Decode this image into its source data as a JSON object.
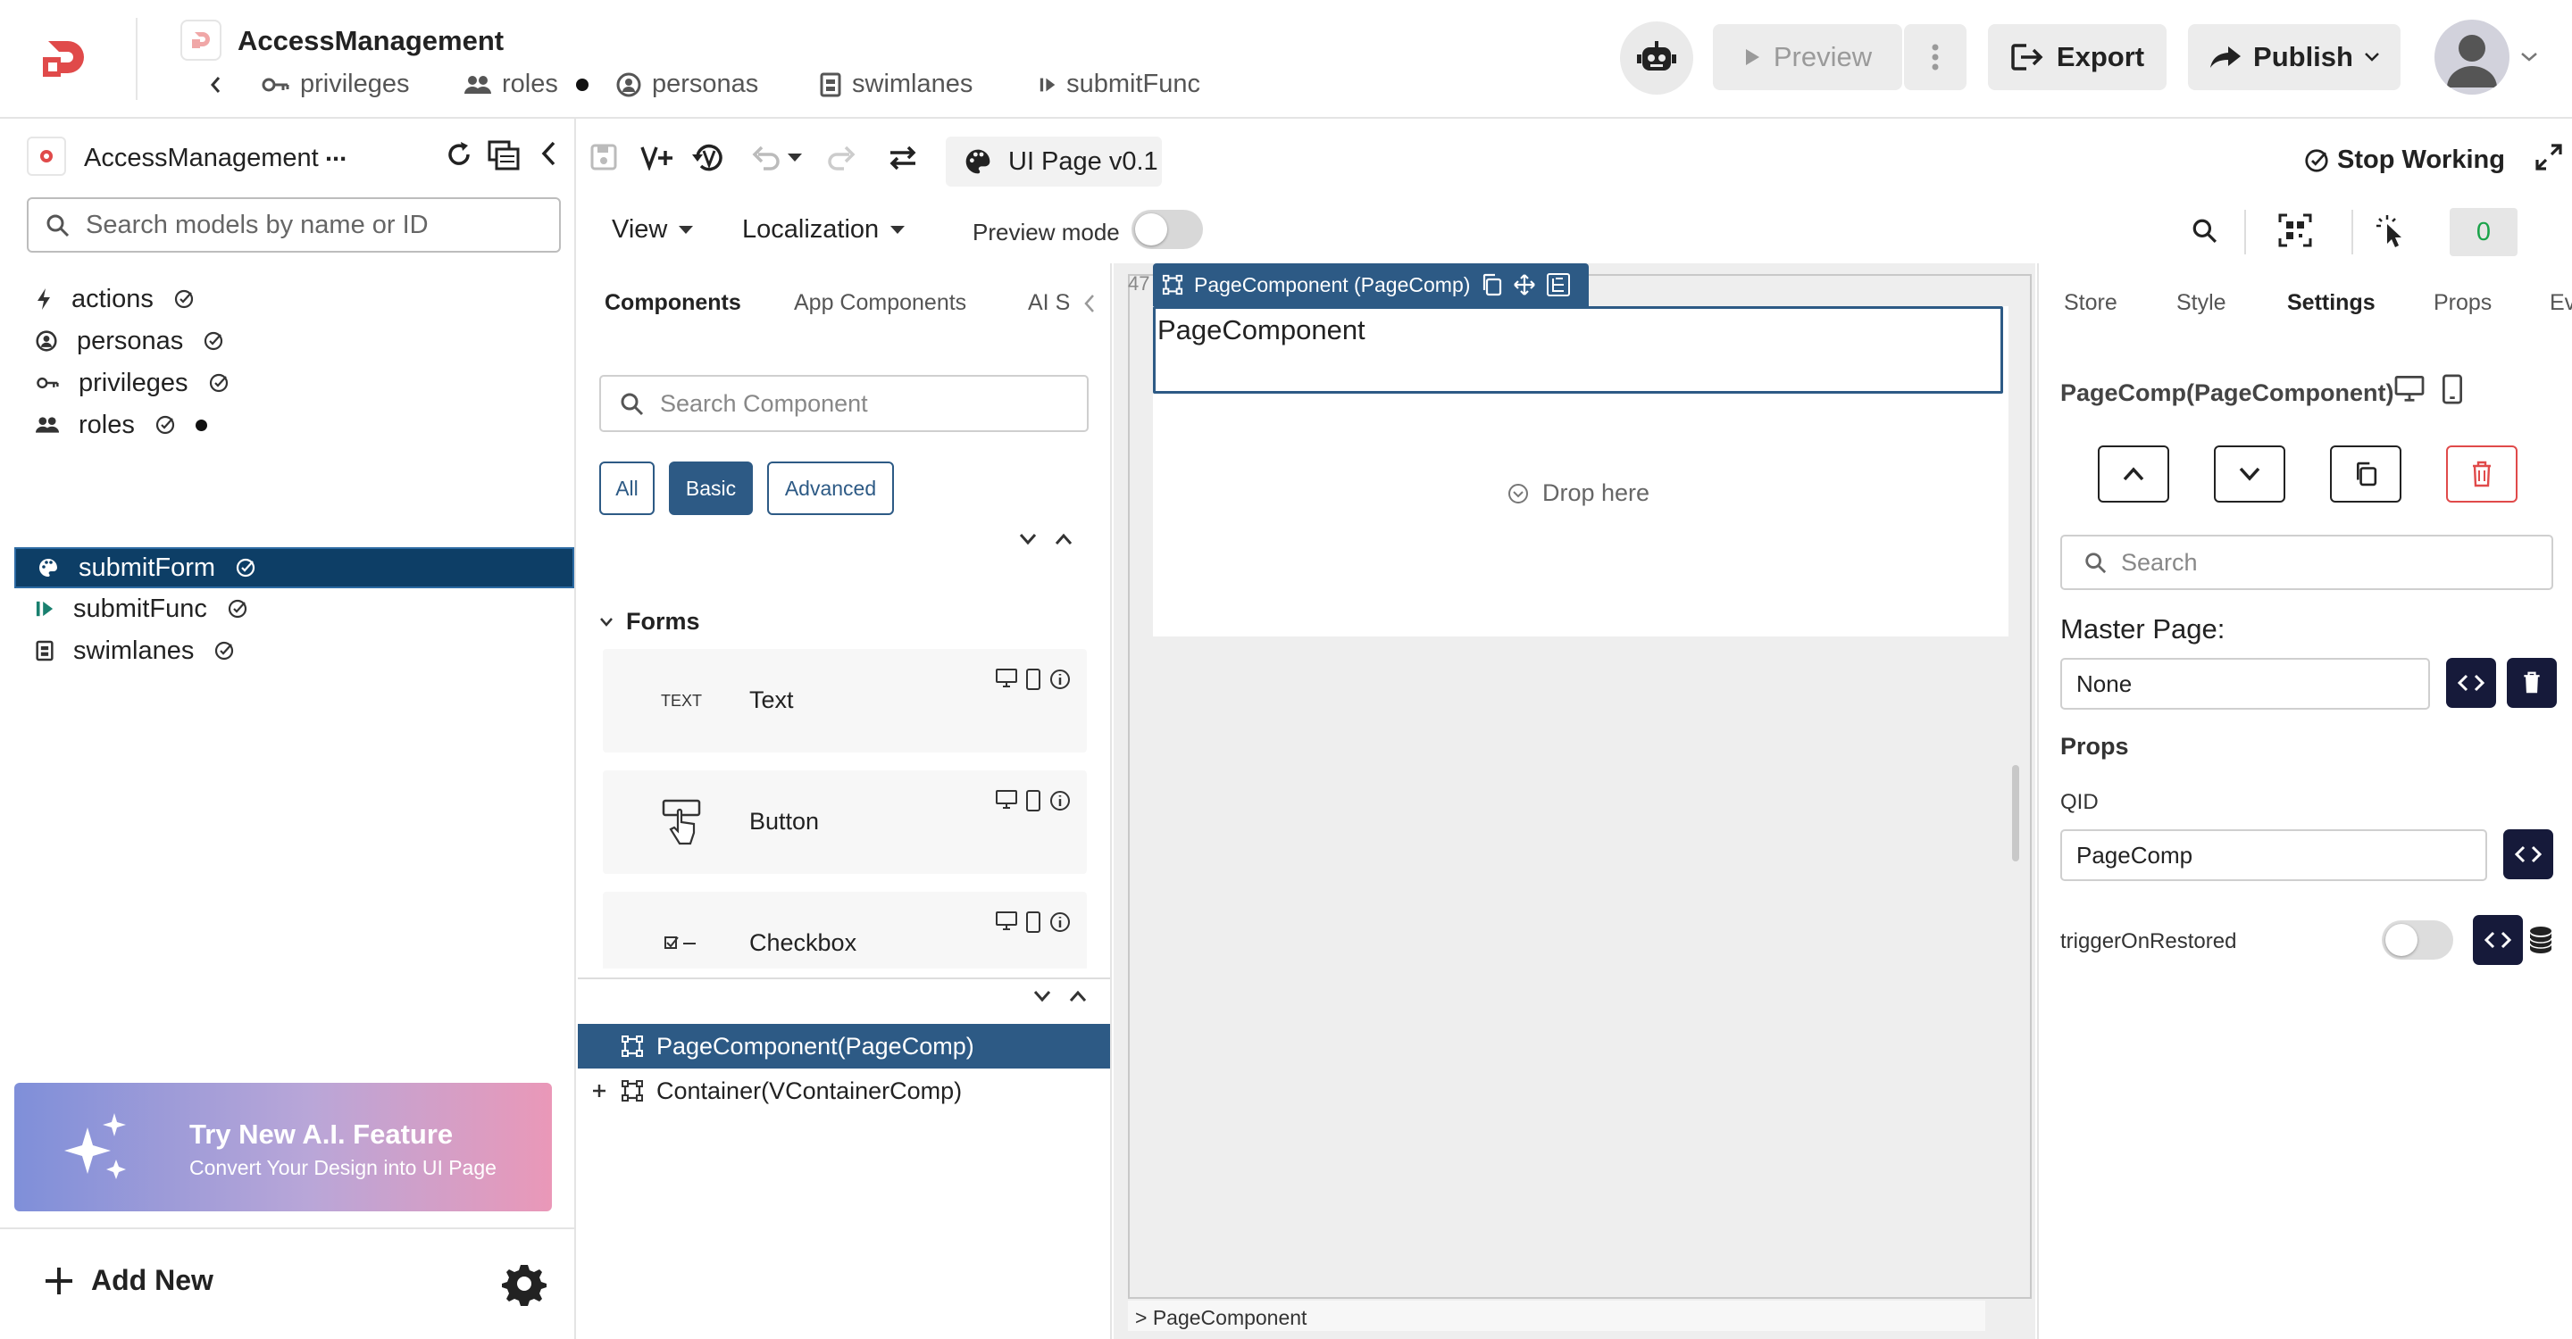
{
  "app": {
    "title": "AccessManagement",
    "nav_tabs": [
      "privileges",
      "roles",
      "personas",
      "swimlanes",
      "submitFunc"
    ],
    "preview_label": "Preview",
    "export_label": "Export",
    "publish_label": "Publish"
  },
  "sidebar": {
    "project_name": "AccessManagement",
    "more_label": "...",
    "search_placeholder": "Search models by name or ID",
    "items": [
      {
        "label": "actions",
        "icon": "bolt-icon"
      },
      {
        "label": "personas",
        "icon": "user-circle-icon"
      },
      {
        "label": "privileges",
        "icon": "key-icon"
      },
      {
        "label": "roles",
        "icon": "group-icon"
      },
      {
        "label": "submitForm",
        "icon": "palette-icon"
      },
      {
        "label": "submitFunc",
        "icon": "play-icon"
      },
      {
        "label": "swimlanes",
        "icon": "swimlane-icon"
      }
    ],
    "ai_banner": {
      "title": "Try New A.I. Feature",
      "subtitle": "Convert Your Design into UI Page"
    },
    "add_new_label": "Add New"
  },
  "toolbar": {
    "page_version": "UI Page v0.1",
    "stop_working_label": "Stop Working",
    "view_label": "View",
    "localization_label": "Localization",
    "preview_mode_label": "Preview mode",
    "counter": "0"
  },
  "components_panel": {
    "tabs": [
      "Components",
      "App Components",
      "AI S"
    ],
    "search_placeholder": "Search Component",
    "filters": [
      "All",
      "Basic",
      "Advanced"
    ],
    "group_label": "Forms",
    "components": [
      {
        "name": "Text",
        "icon_text": "TEXT"
      },
      {
        "name": "Button",
        "icon_text": ""
      },
      {
        "name": "Checkbox",
        "icon_text": ""
      }
    ],
    "tree": [
      {
        "label": "PageComponent(PageComp)"
      },
      {
        "label": "Container(VContainerComp)"
      }
    ]
  },
  "canvas": {
    "ruler_label": "47",
    "selected_label": "PageComponent (PageComp)",
    "page_component_text": "PageComponent",
    "drop_here_label": "Drop here",
    "breadcrumb": "> PageComponent"
  },
  "right_panel": {
    "tabs": [
      "Store",
      "Style",
      "Settings",
      "Props",
      "Ev"
    ],
    "component_title": "PageComp(PageComponent)",
    "search_placeholder": "Search",
    "master_page_label": "Master Page:",
    "master_page_value": "None",
    "props_label": "Props",
    "qid_label": "QID",
    "qid_value": "PageComp",
    "trigger_label": "triggerOnRestored"
  }
}
